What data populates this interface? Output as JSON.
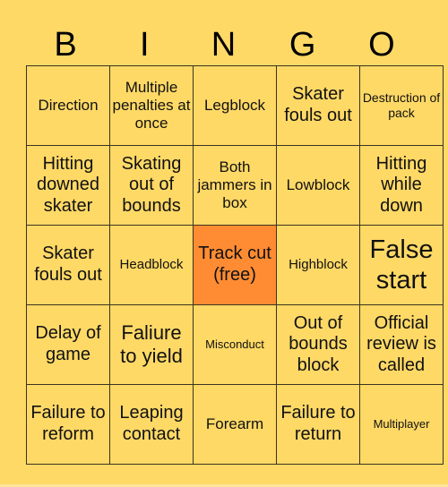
{
  "header": {
    "letters": [
      "B",
      "I",
      "N",
      "G",
      "O"
    ]
  },
  "colors": {
    "background": "#FFD966",
    "free_cell": "#FF8C33",
    "grid_line": "#3a3320"
  },
  "board": {
    "rows": [
      [
        "Direction",
        "Multiple penalties at once",
        "Legblock",
        "Skater fouls out",
        "Destruction of pack"
      ],
      [
        "Hitting downed skater",
        "Skating out of bounds",
        "Both jammers in box",
        "Lowblock",
        "Hitting while down"
      ],
      [
        "Skater fouls out",
        "Headblock",
        "Track cut (free)",
        "Highblock",
        "False start"
      ],
      [
        "Delay of game",
        "Faliure to yield",
        "Misconduct",
        "Out of bounds block",
        "Official review is called"
      ],
      [
        "Failure to reform",
        "Leaping contact",
        "Forearm",
        "Failure to return",
        "Multiplayer"
      ]
    ],
    "free_cell": {
      "row": 2,
      "col": 2
    }
  }
}
